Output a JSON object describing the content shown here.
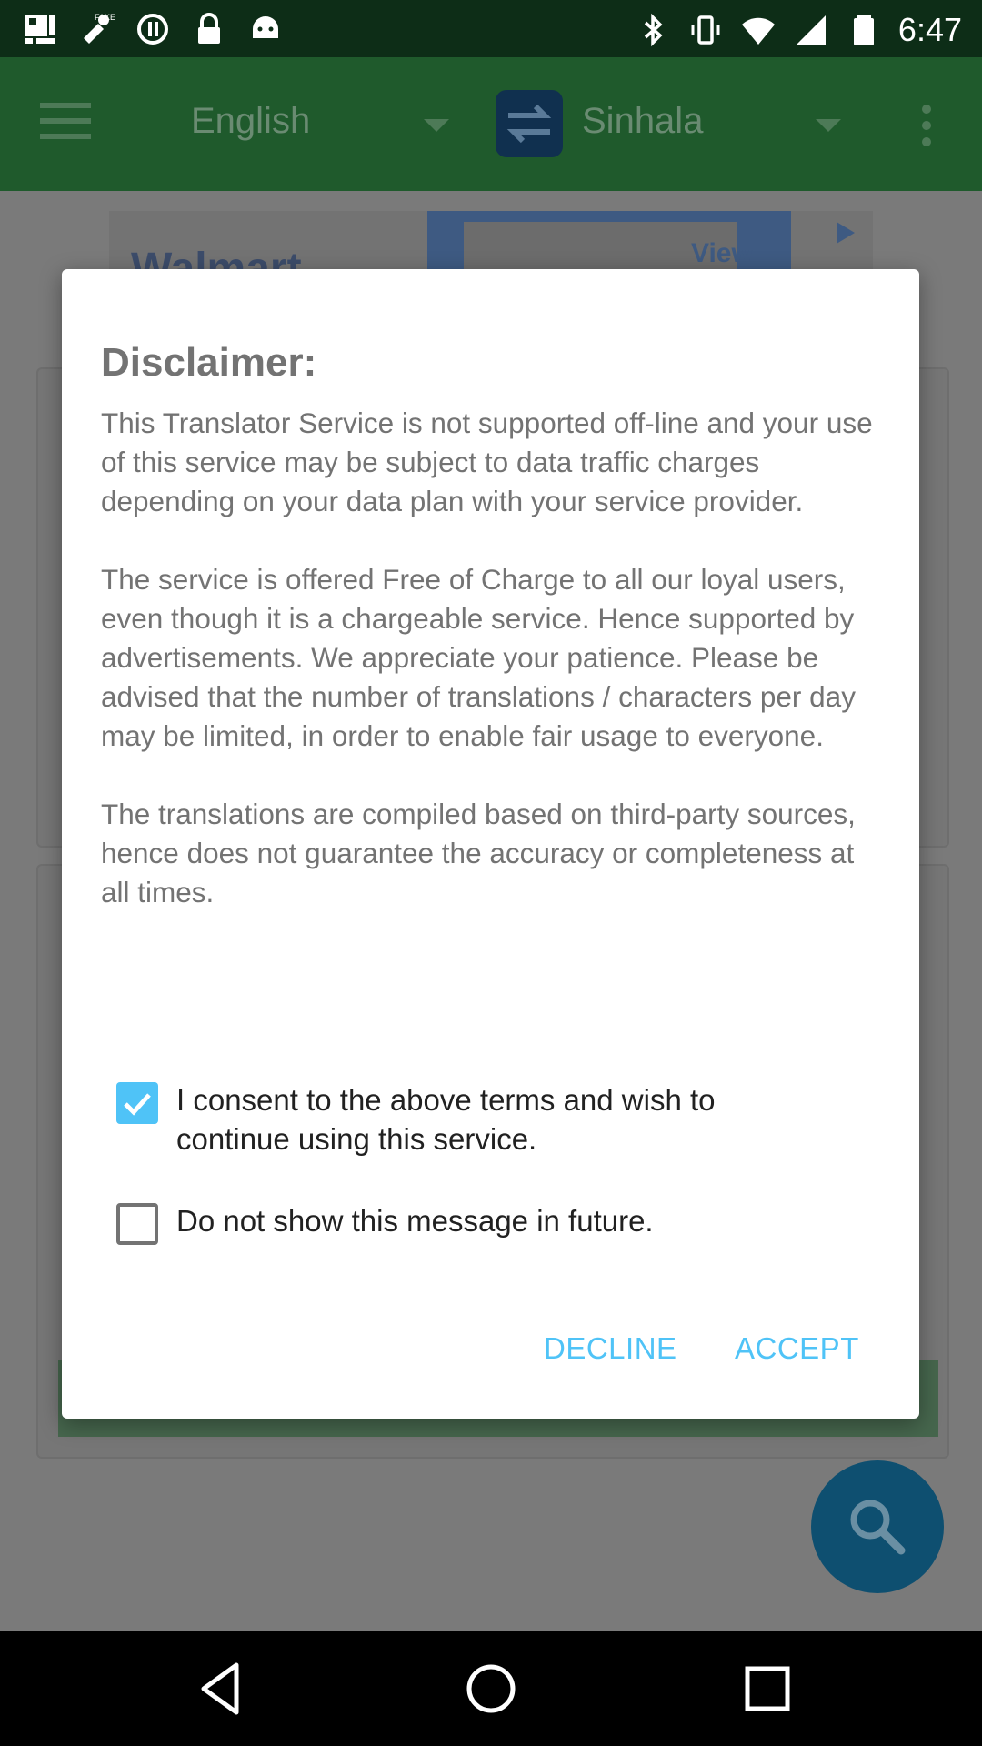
{
  "status_bar": {
    "time": "6:47",
    "left_icons": [
      "notification-icon",
      "fake-gps-icon",
      "sync-circle-icon",
      "lock-icon",
      "android-icon"
    ],
    "right_icons": [
      "bluetooth-icon",
      "vibrate-icon",
      "wifi-icon",
      "signal-icon",
      "battery-icon"
    ]
  },
  "toolbar": {
    "source_language": "English",
    "target_language": "Sinhala"
  },
  "ad": {
    "brand": "Walmart",
    "cta": "View"
  },
  "dialog": {
    "title": "Disclaimer:",
    "paragraphs": [
      "This Translator Service is not supported off-line and your use of this service may be subject to data traffic charges depending on your data plan with your service provider.",
      "The service is offered Free of Charge to all our loyal users, even though it is a chargeable service. Hence supported by advertisements. We appreciate your patience. Please be advised that the number of translations / characters per day may be limited, in order to enable fair usage to everyone.",
      "The translations are compiled based on third-party sources, hence does not guarantee the accuracy or completeness at all times."
    ],
    "consent_label": "I consent to the above terms and wish to continue using this service.",
    "consent_checked": true,
    "dont_show_label": "Do not show this message in future.",
    "dont_show_checked": false,
    "decline_label": "DECLINE",
    "accept_label": "ACCEPT",
    "accent_color": "#4fc3f7"
  },
  "nav_bar": {
    "buttons": [
      "back-icon",
      "home-icon",
      "recents-icon"
    ]
  }
}
